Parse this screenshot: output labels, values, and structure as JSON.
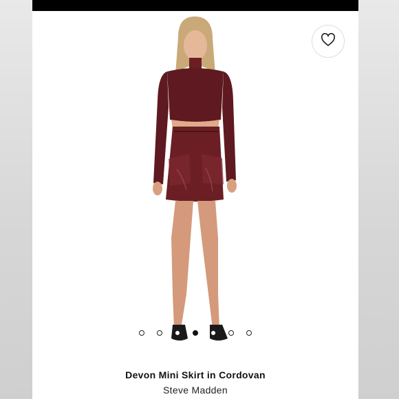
{
  "product": {
    "title": "Devon Mini Skirt in Cordovan",
    "brand": "Steve Madden"
  },
  "carousel": {
    "total": 7,
    "active_index": 3
  },
  "icons": {
    "favorite": "heart-outline-icon"
  },
  "colors": {
    "garment": "#6b1f24",
    "top_bar": "#000000"
  }
}
